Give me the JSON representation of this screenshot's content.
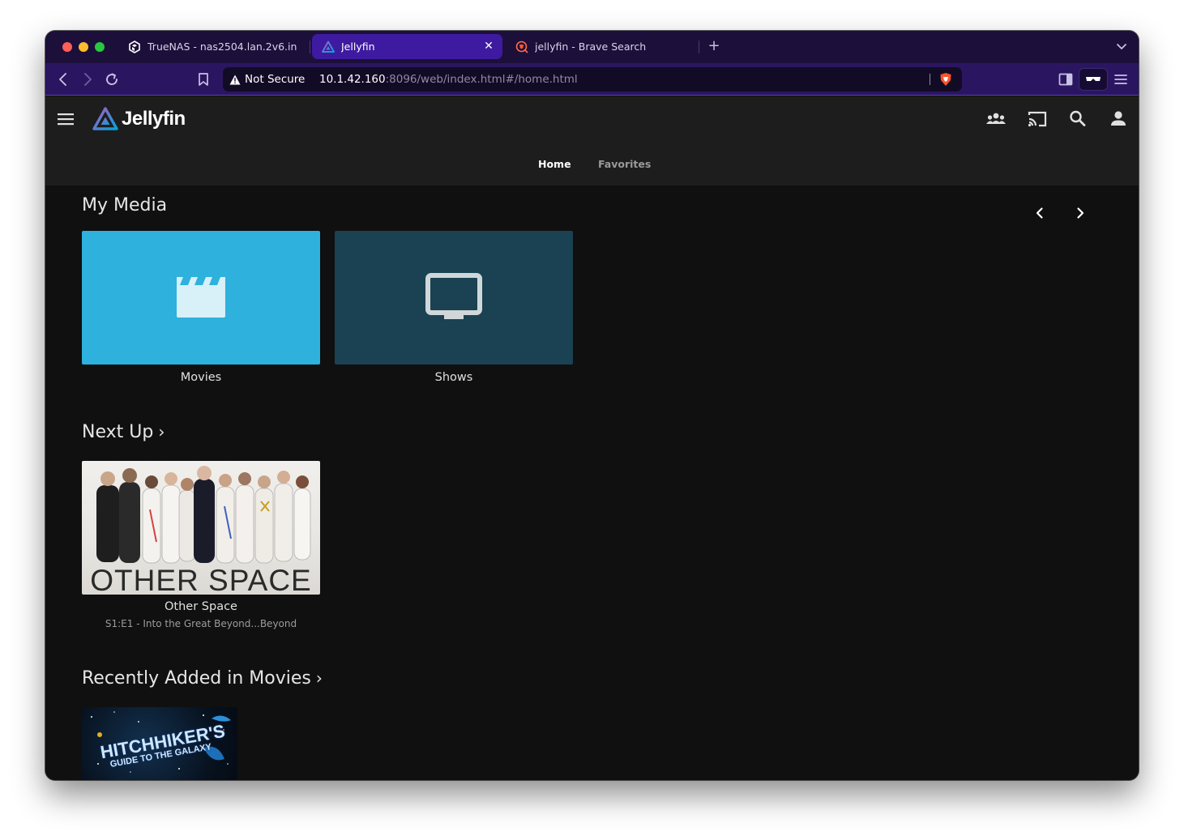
{
  "browser": {
    "tabs": [
      {
        "label": "TrueNAS - nas2504.lan.2v6.in",
        "icon": "truenas-icon"
      },
      {
        "label": "Jellyfin",
        "icon": "jellyfin-icon",
        "active": true
      },
      {
        "label": "jellyfin - Brave Search",
        "icon": "brave-search-icon"
      }
    ],
    "new_tab": "+",
    "security_label": "Not Secure",
    "url_host": "10.1.42.160",
    "url_rest": ":8096/web/index.html#/home.html"
  },
  "app": {
    "logo_text": "Jellyfin",
    "header_tabs": [
      {
        "label": "Home",
        "active": true
      },
      {
        "label": "Favorites",
        "active": false
      }
    ]
  },
  "sections": {
    "my_media": {
      "title": "My Media",
      "items": [
        {
          "label": "Movies",
          "icon": "film-clapper-icon",
          "color": "#2eb1dc"
        },
        {
          "label": "Shows",
          "icon": "tv-icon",
          "color": "#1a4252"
        }
      ]
    },
    "next_up": {
      "title": "Next Up",
      "items": [
        {
          "title": "Other Space",
          "subtitle": "S1:E1 - Into the Great Beyond...Beyond",
          "art_text": "OTHER SPACE"
        }
      ]
    },
    "recently_added_movies": {
      "title": "Recently Added in Movies",
      "items": [
        {
          "art_text_1": "HITCHHIKER'S",
          "art_text_2": "GUIDE TO THE GALAXY"
        }
      ]
    }
  },
  "colors": {
    "accent_purple": "#3e1aa0",
    "app_background": "#101010",
    "header_background": "#1d1d1d"
  }
}
